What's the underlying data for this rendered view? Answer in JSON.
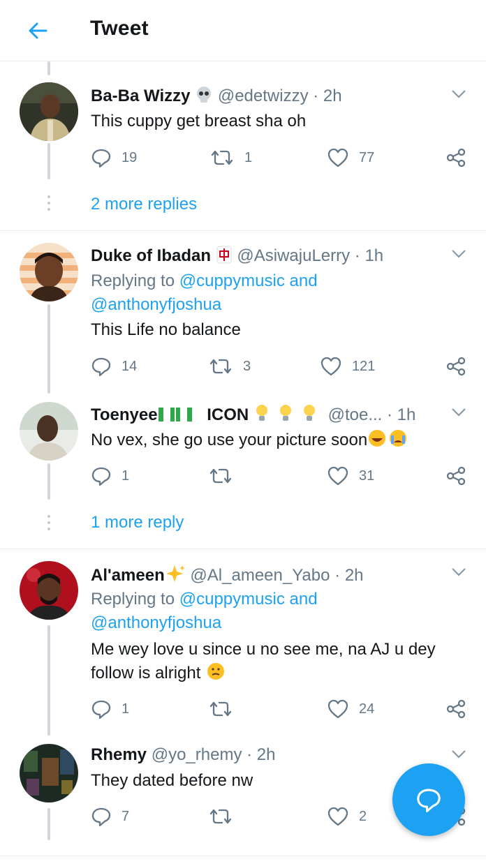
{
  "header": {
    "title": "Tweet"
  },
  "tweets": [
    {
      "name": "Ba-Ba Wizzy",
      "handle": "@edetwizzy",
      "time": "2h",
      "text": "This cuppy get breast sha oh",
      "replies": "19",
      "retweets": "1",
      "likes": "77",
      "more": "2 more replies"
    },
    {
      "name": "Duke of Ibadan",
      "handle": "@AsiwajuLerry",
      "time": "1h",
      "replying_prefix": "Replying to ",
      "replying_link1": "@cuppymusic and",
      "replying_link2": "@anthonyfjoshua",
      "text": "This Life no balance",
      "replies": "14",
      "retweets": "3",
      "likes": "121"
    },
    {
      "name": "Toenyee",
      "name_suffix": "ICON",
      "handle": "@toe...",
      "time": "1h",
      "text": "No vex, she go use your picture soon",
      "replies": "1",
      "retweets": "",
      "likes": "31",
      "more": "1 more reply"
    },
    {
      "name": "Al'ameen",
      "handle": "@Al_ameen_Yabo",
      "time": "2h",
      "replying_prefix": "Replying to ",
      "replying_link1": "@cuppymusic and",
      "replying_link2": "@anthonyfjoshua",
      "text_line1": "Me wey love u since u no see me, na AJ u dey",
      "text_line2": "follow is alright",
      "replies": "1",
      "retweets": "",
      "likes": "24"
    },
    {
      "name": "Rhemy",
      "handle": "@yo_rhemy",
      "time": "2h",
      "text": "They dated before nw",
      "replies": "7",
      "retweets": "",
      "likes": "2"
    }
  ],
  "separator": " · ",
  "colors": {
    "accent": "#1da1f2",
    "muted": "#657786",
    "text": "#14171a",
    "border": "#e6ecf0"
  }
}
